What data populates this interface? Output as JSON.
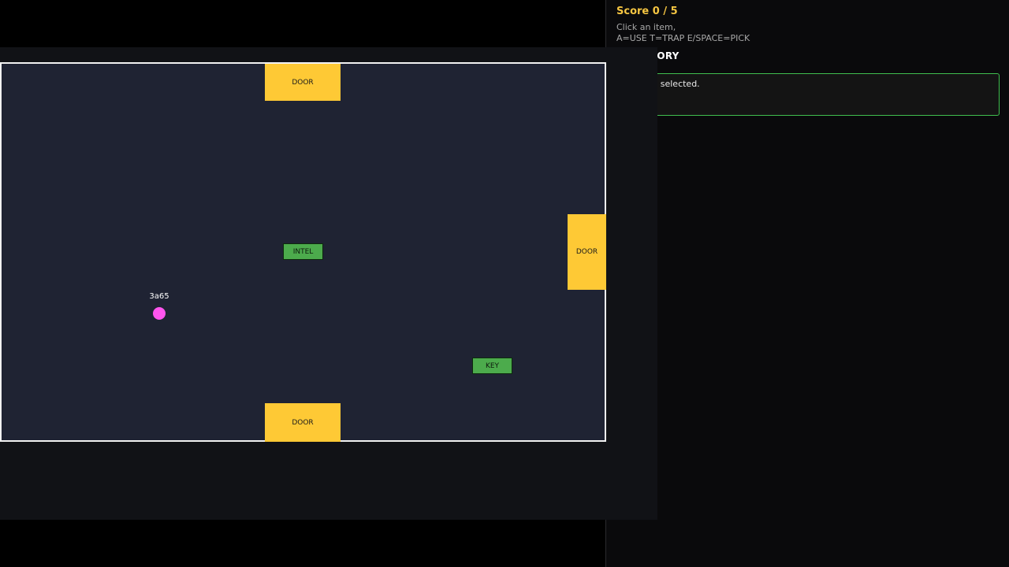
{
  "hud": {
    "score": "Score 0 / 5",
    "help_line1": "Click an item,",
    "help_line2": "A=USE T=TRAP E/SPACE=PICK"
  },
  "inventory": {
    "title": "INVENTORY",
    "message": "Nothing selected."
  },
  "arena": {
    "doors": [
      "DOOR",
      "DOOR",
      "DOOR"
    ],
    "items": [
      "INTEL",
      "KEY"
    ],
    "player_id": "3a65"
  },
  "colors": {
    "arena_bg": "#1f2333",
    "door": "#fec935",
    "item": "#4cab4c",
    "player": "#ff55ee",
    "score": "#f5c542",
    "inventory_border": "#3fbf4f"
  }
}
